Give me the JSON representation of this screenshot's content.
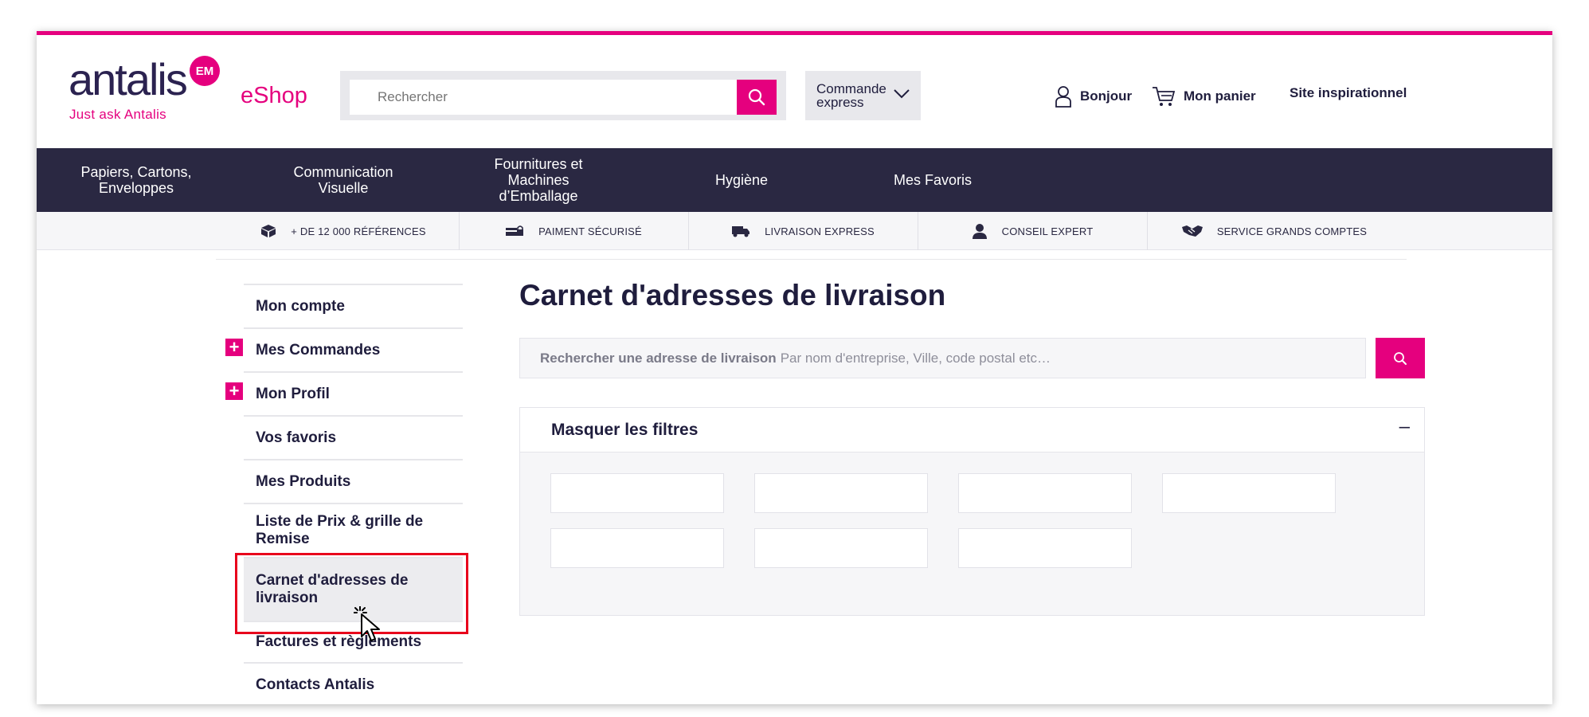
{
  "brand": {
    "logo_word": "antalis",
    "logo_badge": "EM",
    "tagline": "Just ask Antalis",
    "eshop": "eShop"
  },
  "header": {
    "search_placeholder": "Rechercher",
    "commande_express": "Commande express",
    "bonjour": "Bonjour",
    "panier": "Mon panier",
    "site_inspirationnel": "Site inspirationnel"
  },
  "nav": {
    "items": [
      {
        "label": "Papiers, Cartons, Enveloppes"
      },
      {
        "label": "Communication Visuelle"
      },
      {
        "label": "Fournitures et Machines d’Emballage"
      },
      {
        "label": "Hygiène"
      },
      {
        "label": "Mes Favoris"
      }
    ]
  },
  "benefits": [
    {
      "label": "+ DE 12 000 RÉFÉRENCES",
      "icon": "box-icon"
    },
    {
      "label": "PAIMENT SÉCURISÉ",
      "icon": "secure-card-icon"
    },
    {
      "label": "LIVRAISON EXPRESS",
      "icon": "truck-icon"
    },
    {
      "label": "CONSEIL EXPERT",
      "icon": "person-icon"
    },
    {
      "label": "SERVICE GRANDS COMPTES",
      "icon": "handshake-icon"
    }
  ],
  "sidebar": {
    "items": [
      {
        "label": "Mon compte"
      },
      {
        "label": "Mes Commandes",
        "expandable": true
      },
      {
        "label": "Mon Profil",
        "expandable": true
      },
      {
        "label": "Vos favoris"
      },
      {
        "label": "Mes Produits"
      },
      {
        "label": "Liste de Prix & grille de Remise"
      },
      {
        "label": "Carnet d'adresses de livraison",
        "active": true
      },
      {
        "label": "Factures et règlements"
      },
      {
        "label": "Contacts Antalis"
      }
    ],
    "plus_symbol": "+"
  },
  "main": {
    "title": "Carnet d'adresses de livraison",
    "search_label": "Rechercher une adresse de livraison",
    "search_hint": "Par nom d'entreprise, Ville, code postal etc…",
    "filters_title": "Masquer les filtres",
    "filters_toggle": "–"
  },
  "colors": {
    "accent": "#e5007e",
    "nav_bg": "#2a2842",
    "text": "#1f1d3d",
    "highlight": "#e8001c"
  }
}
